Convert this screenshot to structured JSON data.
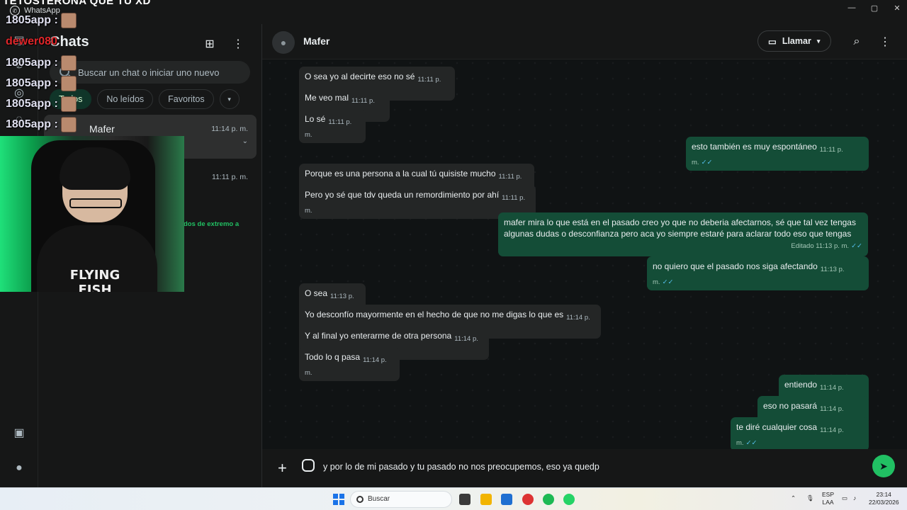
{
  "overlay": {
    "stream_title": "TETOSTERONA QUE TU XD",
    "chat_lines": [
      {
        "user": "1805app :",
        "red": false
      },
      {
        "user": "dewer080",
        "red": true
      },
      {
        "user": "1805app :",
        "red": false
      },
      {
        "user": "1805app :",
        "red": false
      },
      {
        "user": "1805app :",
        "red": false
      },
      {
        "user": "1805app :",
        "red": false
      }
    ],
    "shirt_text": "FLYING FISH"
  },
  "window": {
    "app_name": "WhatsApp",
    "minimize": "—",
    "maximize": "▢",
    "close": "✕"
  },
  "sidebar": {
    "title": "Chats",
    "search_placeholder": "Buscar un chat o iniciar uno nuevo",
    "filters": [
      "Todos",
      "No leídos",
      "Favoritos"
    ],
    "filter_more": "▾",
    "chats": [
      {
        "name": "Mafer",
        "time": "11:14 p. m."
      },
      {
        "name": "",
        "time": "11:11 p. m."
      }
    ],
    "snippet": "dos de extremo a"
  },
  "conversation": {
    "contact_name": "Mafer",
    "call_label": "Llamar",
    "messages": [
      {
        "dir": "in",
        "text": "O sea yo al decirte eso no sé",
        "time": "11:11 p. m."
      },
      {
        "dir": "in",
        "text": "Me veo mal",
        "time": "11:11 p. m."
      },
      {
        "dir": "in",
        "text": "Lo sé",
        "time": "11:11 p. m."
      },
      {
        "dir": "out",
        "text": "esto también es muy espontáneo",
        "time": "11:11 p. m."
      },
      {
        "dir": "in",
        "text": "Porque es una persona a la cual tú quisiste mucho",
        "time": "11:11 p. m."
      },
      {
        "dir": "in",
        "text": "Pero yo sé que tdv queda un remordimiento por ahí",
        "time": "11:11 p. m."
      },
      {
        "dir": "out",
        "text": "mafer mira lo que está en el pasado creo yo que no deberia afectarnos, sé que tal vez tengas algunas dudas o desconfianza pero aca yo siempre estaré para aclarar todo eso que tengas",
        "meta": "Editado 11:13 p. m."
      },
      {
        "dir": "out",
        "text": "no quiero que el pasado nos siga afectando",
        "time": "11:13 p. m."
      },
      {
        "dir": "in",
        "text": "O sea",
        "time": "11:13 p. m."
      },
      {
        "dir": "in",
        "text": "Yo desconfío mayormente en el hecho de que no me digas lo que es",
        "time": "11:14 p. m."
      },
      {
        "dir": "in",
        "text": "Y al final yo enterarme de otra persona",
        "time": "11:14 p. m."
      },
      {
        "dir": "in",
        "text": "Todo lo q pasa",
        "time": "11:14 p. m."
      },
      {
        "dir": "out",
        "text": "entiendo",
        "time": "11:14 p. m."
      },
      {
        "dir": "out",
        "text": "eso no pasará",
        "time": "11:14 p. m."
      },
      {
        "dir": "out",
        "text": "te diré cualquier cosa",
        "time": "11:14 p. m."
      }
    ],
    "composer_value": "y por lo de mi pasado y tu pasado no nos preocupemos, eso ya quedp"
  },
  "taskbar": {
    "search_label": "Buscar",
    "lang": "ESP",
    "lang2": "LAA",
    "time": "23:14",
    "date": "22/03/2026"
  }
}
